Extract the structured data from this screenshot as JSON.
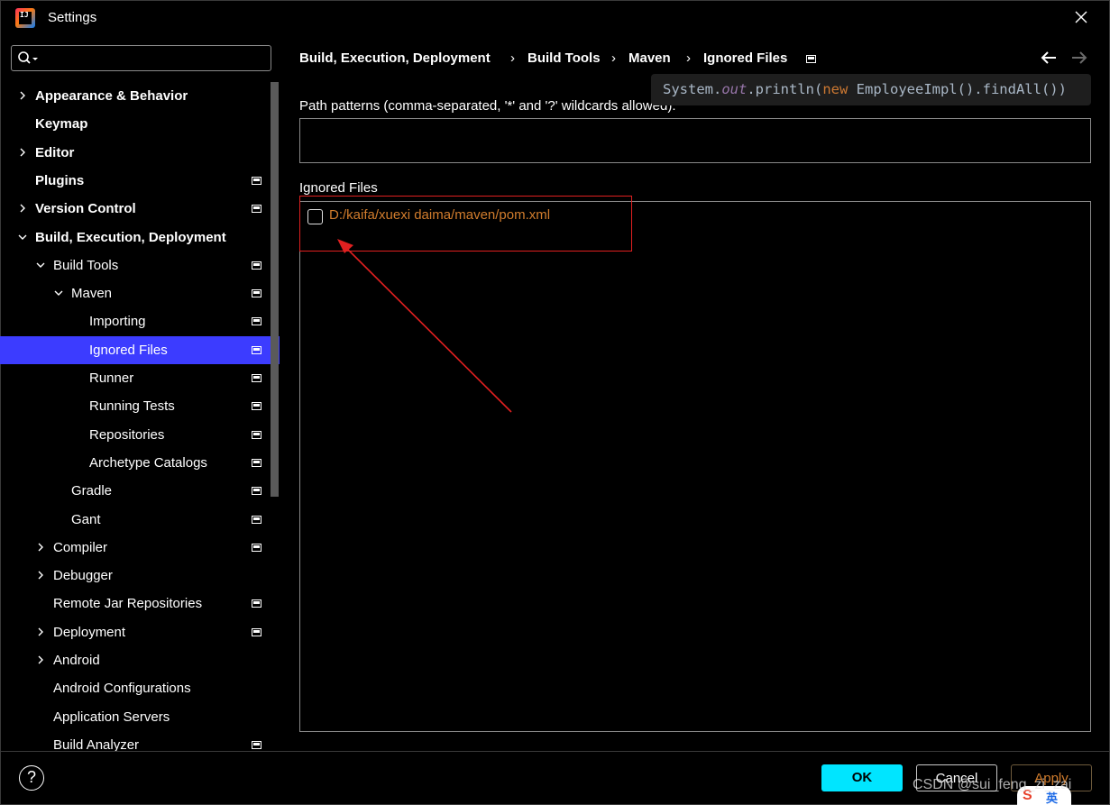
{
  "window": {
    "title": "Settings"
  },
  "search": {
    "placeholder": ""
  },
  "tree": {
    "items": [
      {
        "label": "Appearance & Behavior",
        "bold": true,
        "chevron": "right",
        "level": 0,
        "proj": false
      },
      {
        "label": "Keymap",
        "bold": true,
        "chevron": "",
        "level": 0,
        "proj": false
      },
      {
        "label": "Editor",
        "bold": true,
        "chevron": "right",
        "level": 0,
        "proj": false
      },
      {
        "label": "Plugins",
        "bold": true,
        "chevron": "",
        "level": 0,
        "proj": true
      },
      {
        "label": "Version Control",
        "bold": true,
        "chevron": "right",
        "level": 0,
        "proj": true
      },
      {
        "label": "Build, Execution, Deployment",
        "bold": true,
        "chevron": "down",
        "level": 0,
        "proj": false
      },
      {
        "label": "Build Tools",
        "bold": false,
        "chevron": "down",
        "level": 1,
        "proj": true
      },
      {
        "label": "Maven",
        "bold": false,
        "chevron": "down",
        "level": 2,
        "proj": true
      },
      {
        "label": "Importing",
        "bold": false,
        "chevron": "",
        "level": 3,
        "proj": true
      },
      {
        "label": "Ignored Files",
        "bold": false,
        "chevron": "",
        "level": 3,
        "proj": true,
        "selected": true
      },
      {
        "label": "Runner",
        "bold": false,
        "chevron": "",
        "level": 3,
        "proj": true
      },
      {
        "label": "Running Tests",
        "bold": false,
        "chevron": "",
        "level": 3,
        "proj": true
      },
      {
        "label": "Repositories",
        "bold": false,
        "chevron": "",
        "level": 3,
        "proj": true
      },
      {
        "label": "Archetype Catalogs",
        "bold": false,
        "chevron": "",
        "level": 3,
        "proj": true
      },
      {
        "label": "Gradle",
        "bold": false,
        "chevron": "",
        "level": 2,
        "proj": true
      },
      {
        "label": "Gant",
        "bold": false,
        "chevron": "",
        "level": 2,
        "proj": true
      },
      {
        "label": "Compiler",
        "bold": false,
        "chevron": "right",
        "level": 1,
        "proj": true
      },
      {
        "label": "Debugger",
        "bold": false,
        "chevron": "right",
        "level": 1,
        "proj": false
      },
      {
        "label": "Remote Jar Repositories",
        "bold": false,
        "chevron": "",
        "level": 1,
        "proj": true
      },
      {
        "label": "Deployment",
        "bold": false,
        "chevron": "right",
        "level": 1,
        "proj": true
      },
      {
        "label": "Android",
        "bold": false,
        "chevron": "right",
        "level": 1,
        "proj": false
      },
      {
        "label": "Android Configurations",
        "bold": false,
        "chevron": "",
        "level": 1,
        "proj": false
      },
      {
        "label": "Application Servers",
        "bold": false,
        "chevron": "",
        "level": 1,
        "proj": false
      },
      {
        "label": "Build Analyzer",
        "bold": false,
        "chevron": "",
        "level": 1,
        "proj": true
      }
    ]
  },
  "breadcrumb": {
    "items": [
      "Build, Execution, Deployment",
      "Build Tools",
      "Maven",
      "Ignored Files"
    ],
    "separator": "›"
  },
  "tooltip": {
    "part1": "System.",
    "part2": "out",
    "part3": ".println(",
    "part4": "new",
    "part5": " EmployeeImpl().findAll())"
  },
  "path_patterns": {
    "label": "Path patterns (comma-separated, '*' and '?' wildcards allowed):",
    "value": ""
  },
  "ignored_files": {
    "label": "Ignored Files",
    "files": [
      {
        "path": "D:/kaifa/xuexi  daima/maven/pom.xml",
        "checked": false
      }
    ]
  },
  "buttons": {
    "ok": "OK",
    "cancel": "Cancel",
    "apply": "Apply",
    "help": "?"
  },
  "watermark": "CSDN @sui_feng_zi_zai",
  "ime": {
    "logo": "S",
    "mode": "英"
  },
  "colors": {
    "selection": "#3c3cff",
    "ok_button": "#00e5ff",
    "file_path": "#d27d2d",
    "annotation": "#e02020"
  }
}
